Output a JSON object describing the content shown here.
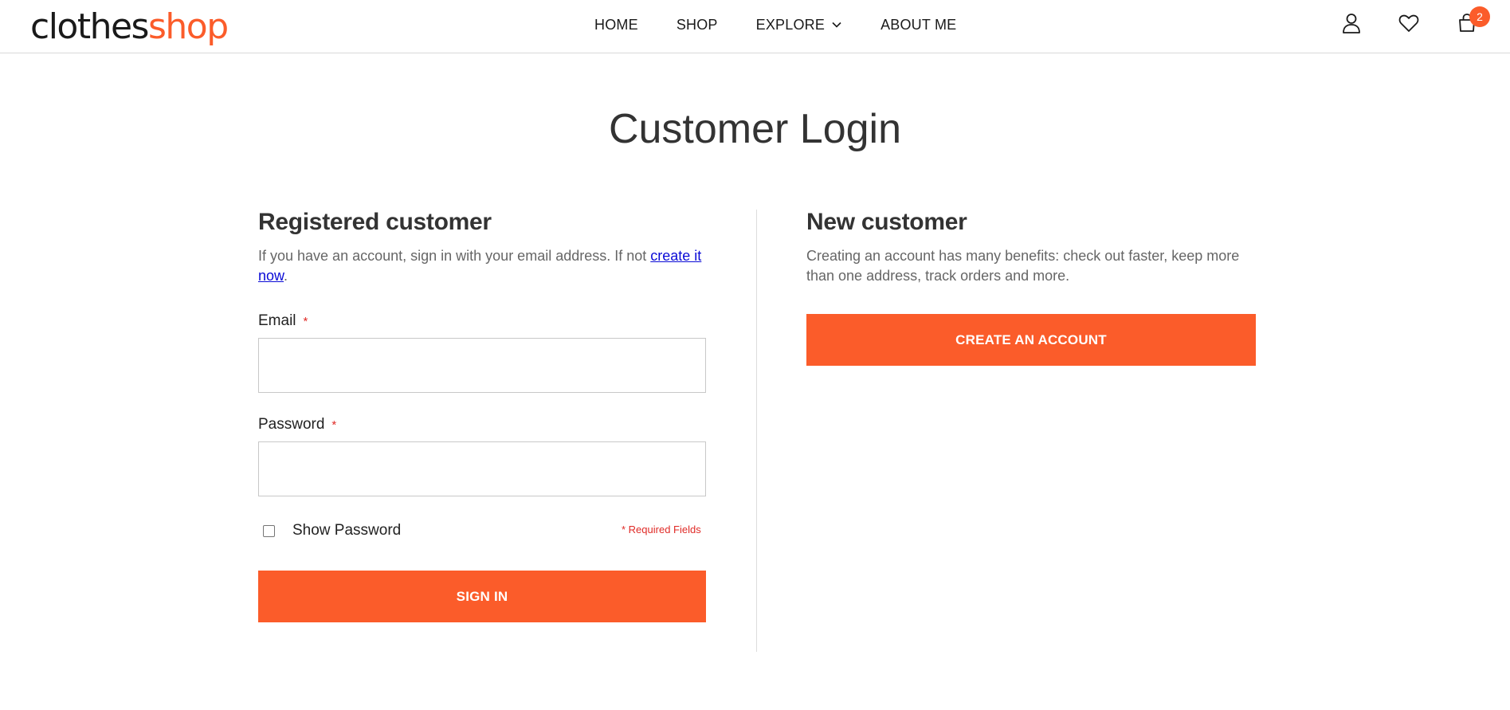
{
  "brand": {
    "part1": "clothes",
    "part2": "shop",
    "accent": "#fb5c2a"
  },
  "nav": {
    "items": [
      {
        "label": "HOME"
      },
      {
        "label": "SHOP"
      },
      {
        "label": "EXPLORE"
      },
      {
        "label": "ABOUT ME"
      }
    ]
  },
  "header_icons": {
    "account": "user-icon",
    "wishlist": "heart-icon",
    "cart": "cart-icon",
    "cart_count": "2"
  },
  "page": {
    "title": "Customer Login"
  },
  "registered": {
    "title": "Registered customer",
    "desc_prefix": "If you have an account, sign in with your email address. If not ",
    "desc_link": "create it now",
    "desc_suffix": ".",
    "email_label": "Email",
    "password_label": "Password",
    "required_marker": "*",
    "email_value": "",
    "password_value": "",
    "show_password_label": "Show Password",
    "show_password_checked": false,
    "required_fields_note": "* Required Fields",
    "sign_in_label": "SIGN IN"
  },
  "new_customer": {
    "title": "New customer",
    "desc": "Creating an account has many benefits: check out faster, keep more than one address, track orders and more.",
    "create_label": "CREATE AN ACCOUNT"
  }
}
